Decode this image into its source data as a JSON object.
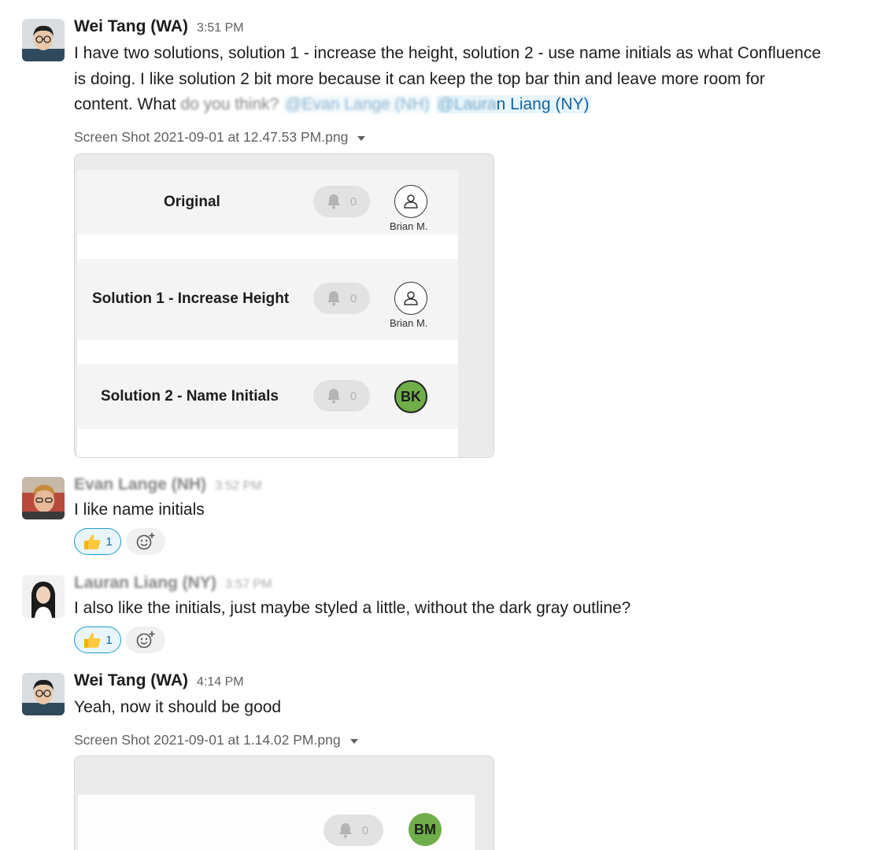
{
  "messages": [
    {
      "author": "Wei Tang (WA)",
      "time": "3:51 PM",
      "text_line1": "I have two solutions, solution 1 - increase the height, solution 2 - use name initials as what Confluence",
      "text_line2": "is doing. I like solution 2 bit more because it can keep the top bar thin and leave more room for",
      "text_line3_start": "content. What ",
      "text_line3_blurred": "do you think?",
      "mention1": "@Evan Lange (NH)",
      "mention2_blurred": "@Laura",
      "mention2_rest": "n Liang (NY)",
      "attachment": {
        "filename": "Screen Shot 2021-09-01 at 12.47.53 PM.png",
        "rows": [
          {
            "title": "Original",
            "count": "0",
            "user_label": "Brian M."
          },
          {
            "title": "Solution 1 - Increase Height",
            "count": "0",
            "user_label": "Brian M."
          },
          {
            "title": "Solution 2 - Name Initials",
            "count": "0",
            "initials": "BK"
          }
        ]
      }
    },
    {
      "author": "Evan Lange (NH)",
      "time": "3:52 PM",
      "text": "I like name initials",
      "reaction_count": "1"
    },
    {
      "author": "Lauran Liang (NY)",
      "time": "3:57 PM",
      "text": "I also like the initials, just maybe styled a little, without the dark gray outline?",
      "reaction_count": "1"
    },
    {
      "author": "Wei Tang (WA)",
      "time": "4:14 PM",
      "text": "Yeah, now it should be good",
      "attachment": {
        "filename": "Screen Shot 2021-09-01 at 1.14.02 PM.png",
        "count": "0",
        "initials": "BM"
      }
    }
  ],
  "colors": {
    "mention_bg": "#e8f5fa",
    "mention_text": "#1264a3",
    "initials_green": "#6fae48",
    "reaction_border": "#1d9bd1"
  },
  "icons": [
    "bell-icon",
    "user-icon",
    "thumbs-up-icon",
    "add-reaction-icon",
    "caret-down-icon"
  ]
}
